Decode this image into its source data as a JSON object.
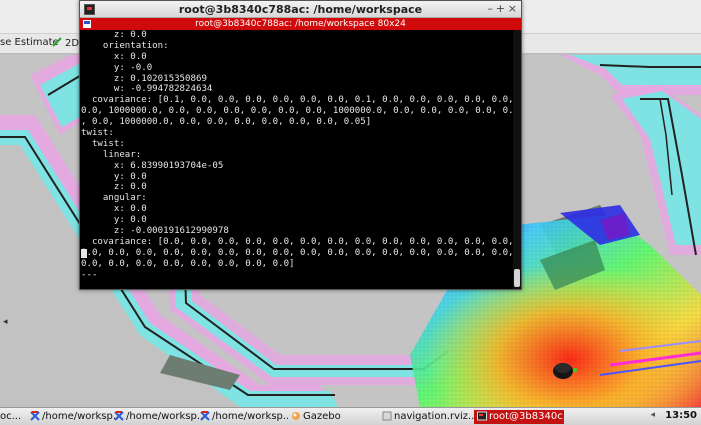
{
  "terminal": {
    "window_title": "root@3b8340c788ac: /home/workspace",
    "tab_title": "root@3b8340c788ac: /home/workspace 80x24",
    "minimize": "–",
    "maximize": "+",
    "close": "×",
    "lines": [
      "      z: 0.0",
      "    orientation:",
      "      x: 0.0",
      "      y: -0.0",
      "      z: 0.102015350869",
      "      w: -0.994782824634",
      "  covariance: [0.1, 0.0, 0.0, 0.0, 0.0, 0.0, 0.0, 0.1, 0.0, 0.0, 0.0, 0.0, 0.0,",
      "0.0, 1000000.0, 0.0, 0.0, 0.0, 0.0, 0.0, 0.0, 1000000.0, 0.0, 0.0, 0.0, 0.0, 0.0",
      ", 0.0, 1000000.0, 0.0, 0.0, 0.0, 0.0, 0.0, 0.0, 0.05]",
      "twist:",
      "  twist:",
      "    linear:",
      "      x: 6.83990193704e-05",
      "      y: 0.0",
      "      z: 0.0",
      "    angular:",
      "      x: 0.0",
      "      y: 0.0",
      "      z: -0.000191612990978",
      "  covariance: [0.0, 0.0, 0.0, 0.0, 0.0, 0.0, 0.0, 0.0, 0.0, 0.0, 0.0, 0.0, 0.0,",
      "0.0, 0.0, 0.0, 0.0, 0.0, 0.0, 0.0, 0.0, 0.0, 0.0, 0.0, 0.0, 0.0, 0.0, 0.0, 0.0,",
      "0.0, 0.0, 0.0, 0.0, 0.0, 0.0, 0.0, 0.0]",
      "---"
    ]
  },
  "rviz": {
    "toolbar": {
      "pose_estimate": "se Estimate",
      "nav_goal": "2D N"
    },
    "left_collapse": "◂"
  },
  "taskbar": {
    "items": [
      {
        "label": "oc...",
        "icon": "cut-off-icon"
      },
      {
        "label": "/home/worksp...",
        "icon": "terminal-x-icon"
      },
      {
        "label": "/home/worksp...",
        "icon": "terminal-x-icon"
      },
      {
        "label": "/home/worksp...",
        "icon": "terminal-x-icon"
      },
      {
        "label": "Gazebo",
        "icon": "gazebo-icon"
      },
      {
        "label": "navigation.rviz...",
        "icon": "rviz-icon"
      },
      {
        "label": "root@3b8340c...",
        "icon": "terminal-icon"
      }
    ],
    "clock": "13:50",
    "tray": "◂"
  },
  "colors": {
    "terminal_tab_red": "#d00a0a",
    "terminal_bg": "#000000",
    "active_task_red": "#c41111",
    "costmap_cyan": "#7fe3e3",
    "inflation_pink": "#e7a6e3"
  }
}
